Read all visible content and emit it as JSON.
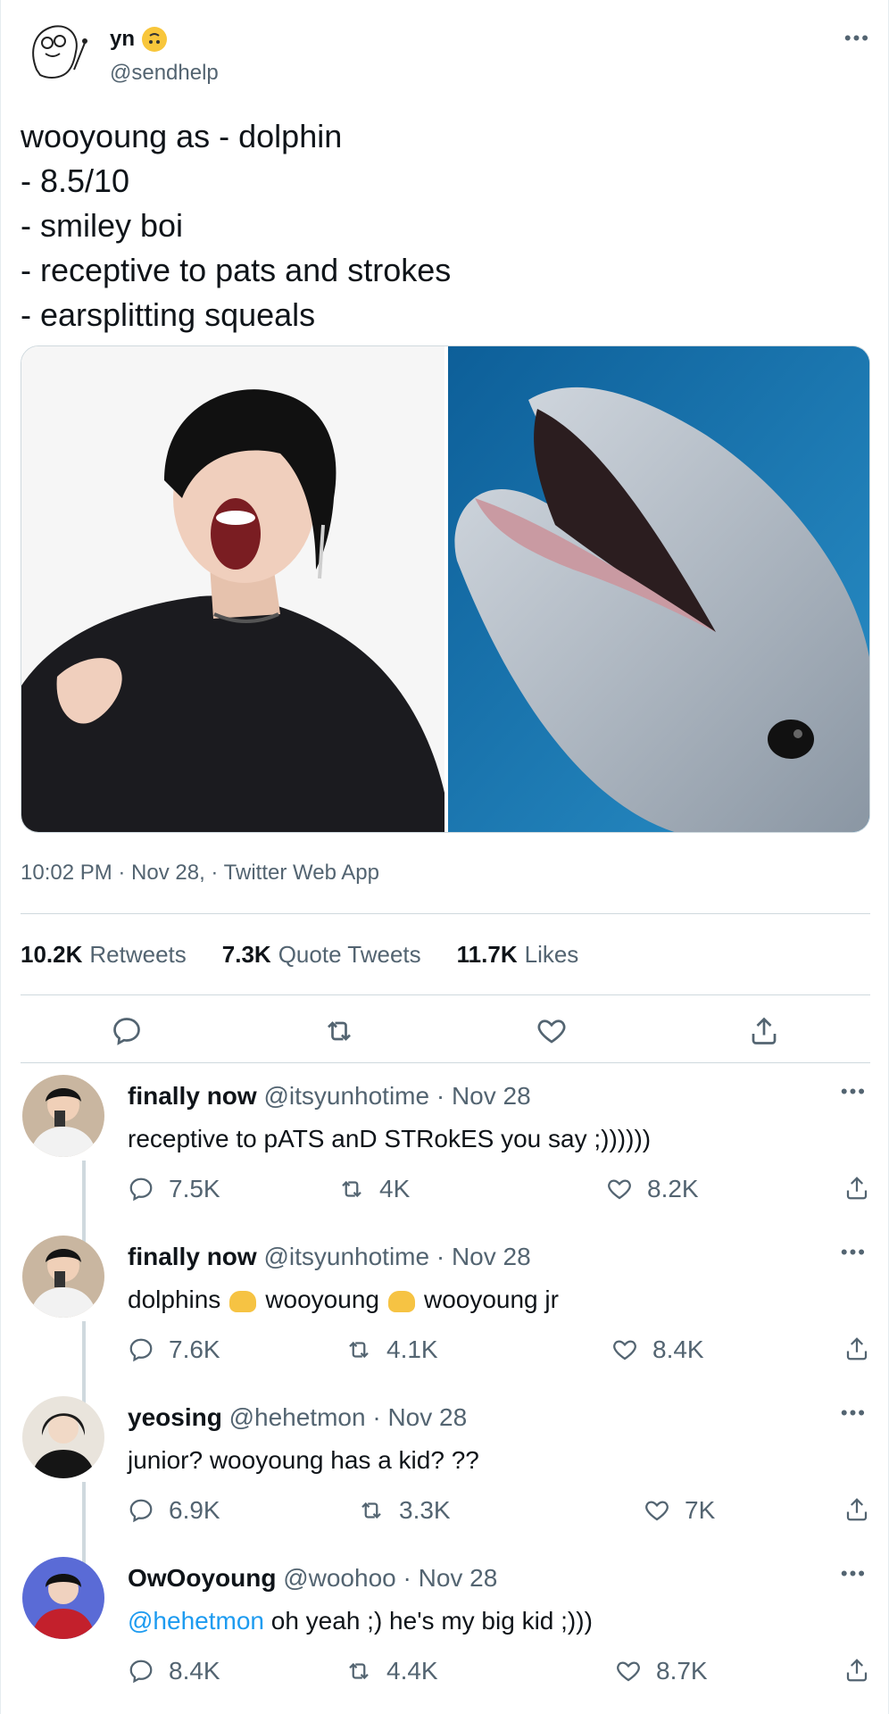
{
  "tweet": {
    "author_name": "yn",
    "author_emoji": "upside-down-face-emoji",
    "handle": "@sendhelp",
    "more": "•••",
    "lines": [
      "wooyoung as - dolphin",
      "- 8.5/10",
      "- smiley boi",
      "- receptive to pats and strokes",
      "- earsplitting squeals"
    ],
    "meta": "10:02 PM · Nov 28, · Twitter Web App",
    "stats": {
      "retweets_count": "10.2K",
      "retweets_label": "Retweets",
      "quotes_count": "7.3K",
      "quotes_label": "Quote Tweets",
      "likes_count": "11.7K",
      "likes_label": "Likes"
    }
  },
  "replies": [
    {
      "name": "finally now",
      "handle": "@itsyunhotime · Nov 28",
      "text": "receptive to pATS anD STRokES you say ;))))))",
      "replies": "7.5K",
      "retweets": "4K",
      "likes": "8.2K"
    },
    {
      "name": "finally now",
      "handle": "@itsyunhotime · Nov 28",
      "text_a": "dolphins",
      "text_b": "wooyoung",
      "text_c": "wooyoung jr",
      "replies": "7.6K",
      "retweets": "4.1K",
      "likes": "8.4K"
    },
    {
      "name": "yeosing",
      "handle": "@hehetmon · Nov 28",
      "text": "junior? wooyoung has a kid? ??",
      "replies": "6.9K",
      "retweets": "3.3K",
      "likes": "7K"
    },
    {
      "name": "OwOoyoung",
      "handle": "@woohoo · Nov 28",
      "mention": "@hehetmon",
      "text": " oh yeah ;) he's my big kid ;)))",
      "replies": "8.4K",
      "retweets": "4.4K",
      "likes": "8.7K"
    }
  ],
  "colors": {
    "accent": "#1d9bf0",
    "muted": "#536471",
    "text": "#0f1419",
    "border": "#cfd9de"
  }
}
